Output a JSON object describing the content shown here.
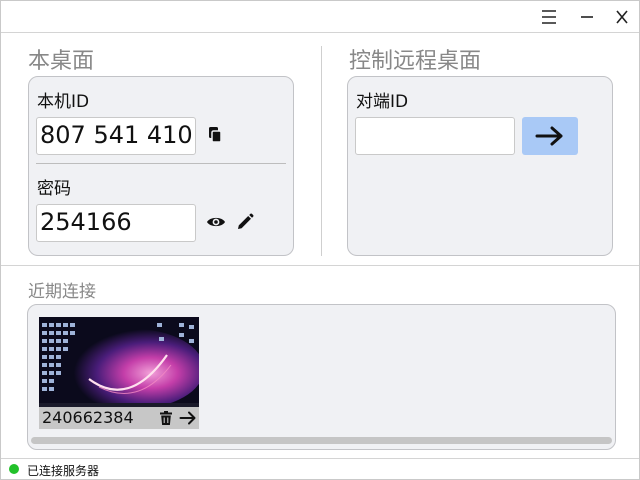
{
  "window": {
    "menu_icon": "hamburger-icon",
    "minimize_icon": "minimize-icon",
    "close_icon": "close-icon"
  },
  "local": {
    "title": "本桌面",
    "id_label": "本机ID",
    "id_value": "807 541 410",
    "password_label": "密码",
    "password_value": "254166",
    "copy_icon": "copy-icon",
    "show_password_icon": "eye-icon",
    "edit_password_icon": "pencil-icon"
  },
  "remote": {
    "title": "控制远程桌面",
    "peer_id_label": "对端ID",
    "peer_id_value": "",
    "connect_icon": "arrow-right-icon",
    "connect_button_color": "#a9c9f6"
  },
  "recent": {
    "title": "近期连接",
    "peers": [
      {
        "id": "240662384",
        "delete_icon": "trash-icon",
        "connect_icon": "arrow-right-icon"
      }
    ]
  },
  "status": {
    "text": "已连接服务器",
    "indicator_color": "#22c12a"
  }
}
